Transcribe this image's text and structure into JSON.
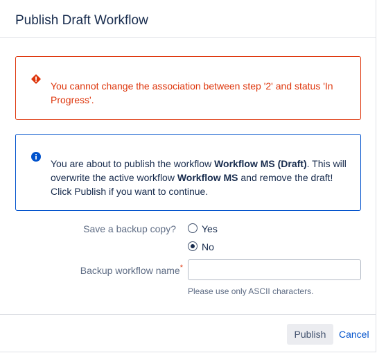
{
  "dialog": {
    "title": "Publish Draft Workflow"
  },
  "error_message": {
    "icon": "error-icon",
    "text": "You cannot change the association between step '2' and status 'In Progress'.",
    "color": "#de350b"
  },
  "info_message": {
    "icon": "info-icon",
    "part1": "You are about to publish the workflow ",
    "workflow_draft": "Workflow MS (Draft)",
    "part2": ". This will overwrite the active workflow ",
    "workflow_active": "Workflow MS",
    "part3": " and remove the draft! Click Publish if you want to continue.",
    "color": "#0052cc"
  },
  "form": {
    "backup_label": "Save a backup copy?",
    "options": [
      {
        "label": "Yes",
        "checked": false
      },
      {
        "label": "No",
        "checked": true
      }
    ],
    "name_label": "Backup workflow name",
    "required_marker": "*",
    "name_value": "",
    "hint": "Please use only ASCII characters."
  },
  "footer": {
    "publish_label": "Publish",
    "cancel_label": "Cancel"
  }
}
